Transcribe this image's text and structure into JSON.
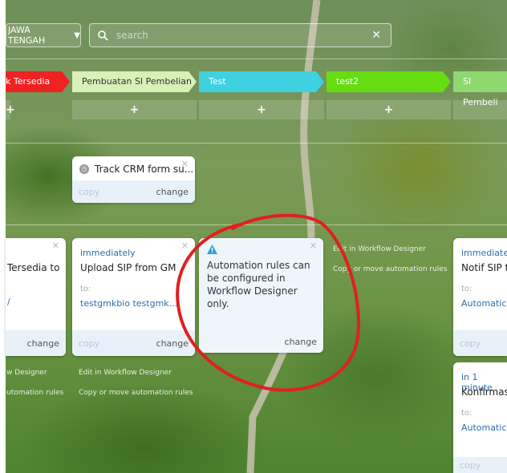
{
  "top": {
    "region": "JAWA TENGAH",
    "search_placeholder": "search"
  },
  "stages": [
    {
      "label": "k Tersedia",
      "color": "#ee2222",
      "text_color": "#ffffff"
    },
    {
      "label": "Pembuatan SI Pembelian",
      "color": "#d9f0b8",
      "text_color": "#333333"
    },
    {
      "label": "Test",
      "color": "#3fd1e0",
      "text_color": "#ffffff"
    },
    {
      "label": "test2",
      "color": "#66dd11",
      "text_color": "#ffffff"
    },
    {
      "label": "SI Pembeli",
      "color": "#8fd870",
      "text_color": "#ffffff"
    }
  ],
  "plus_label": "+",
  "cards": {
    "track_crm": {
      "title": "Track CRM form su...",
      "copy": "copy",
      "change": "change"
    },
    "tersedia": {
      "action": "Tersedia to",
      "to_value": "/",
      "change": "change"
    },
    "upload_sip": {
      "when": "immediately",
      "action": "Upload SIP from GM",
      "to_label": "to:",
      "to_value": "testgmkbio testgmk...",
      "copy": "copy",
      "change": "change"
    },
    "automation_info": {
      "message": "Automation rules can be configured in Workflow Designer only.",
      "change": "change"
    },
    "notif_sip": {
      "when": "immediately",
      "action": "Notif SIP to",
      "to_label": "to:",
      "to_value": "Automatica",
      "copy": "copy"
    },
    "konfirmasi": {
      "when": "in 1 minute",
      "action": "Konfirmasi",
      "to_label": "to:",
      "to_value": "Automatica",
      "copy": "copy"
    }
  },
  "links": {
    "edit_partial_left": "w Designer",
    "copy_partial_left": "utomation rules",
    "edit": "Edit in Workflow Designer",
    "copy_move": "Copy or move automation rules"
  },
  "colors": {
    "card_footer": "#e8f1fa",
    "link_blue": "#2a6db0",
    "annotation_red": "#e02020"
  }
}
